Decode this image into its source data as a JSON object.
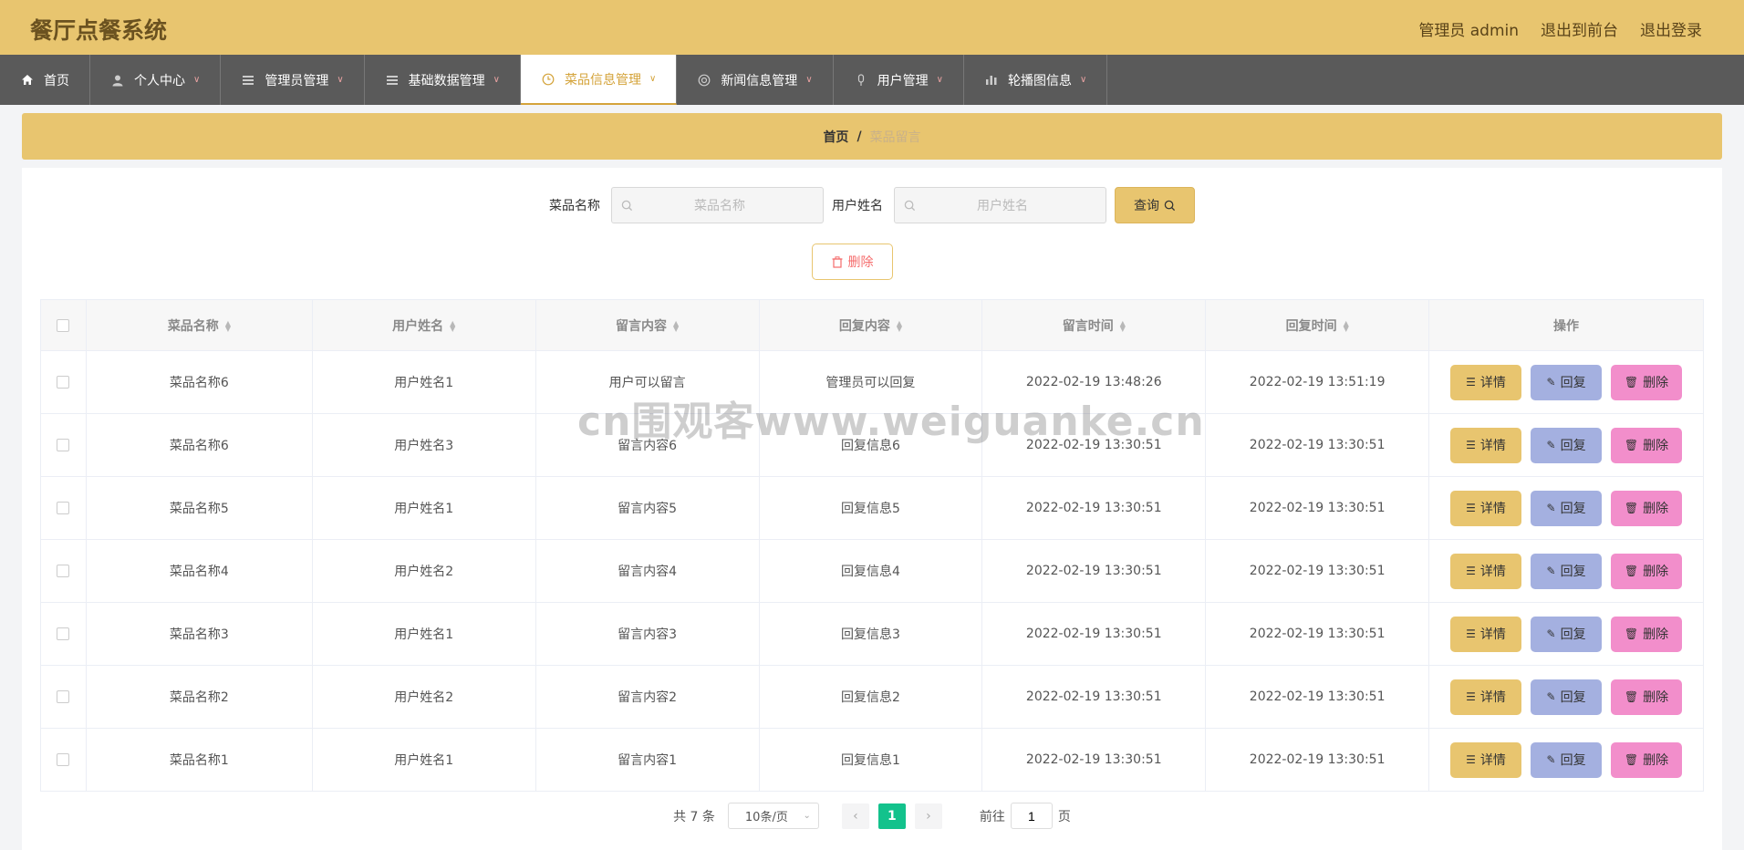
{
  "app": {
    "title": "餐厅点餐系统"
  },
  "header": {
    "admin_label": "管理员 admin",
    "front_link": "退出到前台",
    "logout_link": "退出登录"
  },
  "nav": [
    {
      "label": "首页",
      "icon": "home-icon"
    },
    {
      "label": "个人中心",
      "icon": "user-icon"
    },
    {
      "label": "管理员管理",
      "icon": "menu-icon"
    },
    {
      "label": "基础数据管理",
      "icon": "menu-icon"
    },
    {
      "label": "菜品信息管理",
      "icon": "clock-icon",
      "active": true
    },
    {
      "label": "新闻信息管理",
      "icon": "news-icon"
    },
    {
      "label": "用户管理",
      "icon": "mic-icon"
    },
    {
      "label": "轮播图信息",
      "icon": "bar-chart-icon"
    }
  ],
  "breadcrumb": {
    "home": "首页",
    "sep": "/",
    "current": "菜品留言"
  },
  "search": {
    "dish_label": "菜品名称",
    "dish_placeholder": "菜品名称",
    "user_label": "用户姓名",
    "user_placeholder": "用户姓名",
    "query_button": "查询"
  },
  "toolbar": {
    "delete_button": "删除"
  },
  "table": {
    "headers": [
      "菜品名称",
      "用户姓名",
      "留言内容",
      "回复内容",
      "留言时间",
      "回复时间",
      "操作"
    ],
    "rows": [
      [
        "菜品名称6",
        "用户姓名1",
        "用户可以留言",
        "管理员可以回复",
        "2022-02-19 13:48:26",
        "2022-02-19 13:51:19"
      ],
      [
        "菜品名称6",
        "用户姓名3",
        "留言内容6",
        "回复信息6",
        "2022-02-19 13:30:51",
        "2022-02-19 13:30:51"
      ],
      [
        "菜品名称5",
        "用户姓名1",
        "留言内容5",
        "回复信息5",
        "2022-02-19 13:30:51",
        "2022-02-19 13:30:51"
      ],
      [
        "菜品名称4",
        "用户姓名2",
        "留言内容4",
        "回复信息4",
        "2022-02-19 13:30:51",
        "2022-02-19 13:30:51"
      ],
      [
        "菜品名称3",
        "用户姓名1",
        "留言内容3",
        "回复信息3",
        "2022-02-19 13:30:51",
        "2022-02-19 13:30:51"
      ],
      [
        "菜品名称2",
        "用户姓名2",
        "留言内容2",
        "回复信息2",
        "2022-02-19 13:30:51",
        "2022-02-19 13:30:51"
      ],
      [
        "菜品名称1",
        "用户姓名1",
        "留言内容1",
        "回复信息1",
        "2022-02-19 13:30:51",
        "2022-02-19 13:30:51"
      ]
    ],
    "actions": {
      "detail": "详情",
      "reply": "回复",
      "delete": "删除"
    }
  },
  "pagination": {
    "total": "共 7 条",
    "page_size": "10条/页",
    "current_page": "1",
    "goto_label": "前往",
    "goto_value": "1",
    "page_unit": "页"
  },
  "watermark": "cn围观客www.weiguanke.cn",
  "colors": {
    "accent": "#e8c56f",
    "nav_bg": "#5a5a5a",
    "detail": "#e8c56f",
    "reply": "#a4b0e0",
    "delete": "#f28ecb",
    "page_active": "#13c28c"
  }
}
